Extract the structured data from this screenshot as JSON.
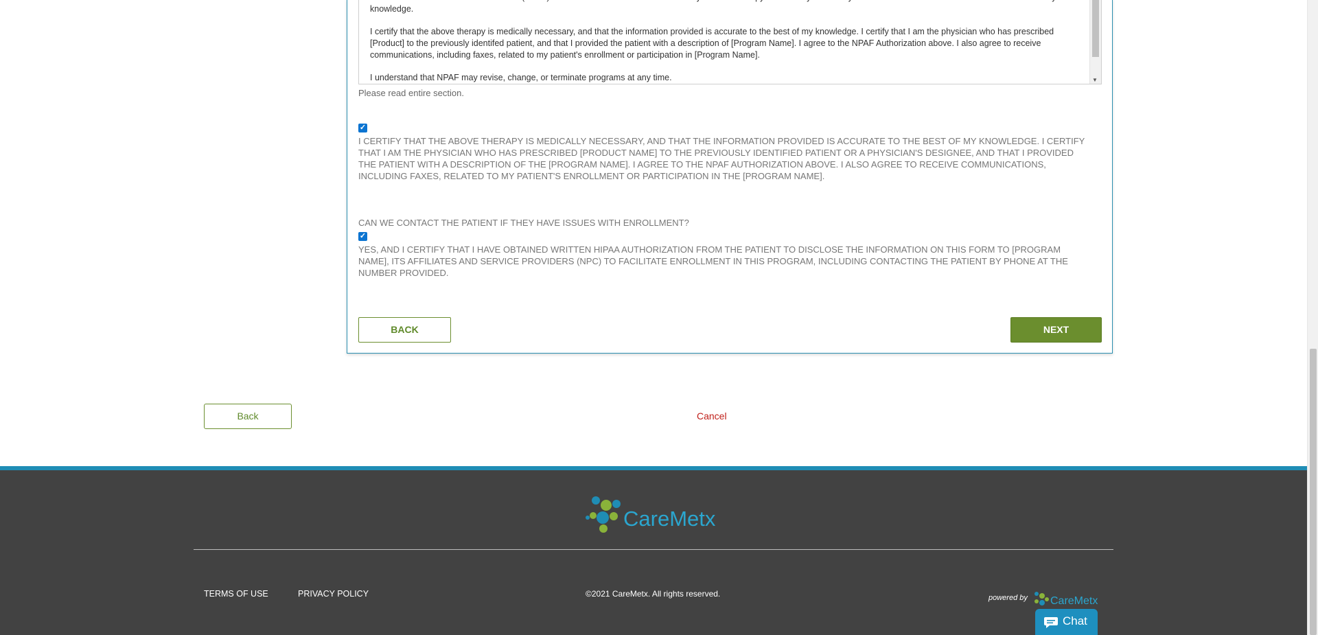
{
  "legal": {
    "paragraphs": [
      "Novartis Patient Assistance Foundation (NPAF) Authorization FOR PHYSICIAN I certify that this therapy is medically necessary and that this information is accurate to the best of my knowledge.",
      "I certify that the above therapy is medically necessary, and that the information provided is accurate to the best of my knowledge. I certify that I am the physician who has prescribed [Product] to the previously identifed patient, and that I provided the patient with a description of [Program Name]. I agree to the NPAF Authorization above. I also agree to receive communications, including faxes, related to my patient's enrollment or participation in [Program Name].",
      "I understand that NPAF may revise, change, or terminate programs at any time."
    ],
    "hint": "Please read entire section."
  },
  "certify": {
    "checked": true,
    "text": "I CERTIFY THAT THE ABOVE THERAPY IS MEDICALLY NECESSARY, AND THAT THE INFORMATION PROVIDED IS ACCURATE TO THE BEST OF MY KNOWLEDGE. I CERTIFY THAT I AM THE PHYSICIAN WHO HAS PRESCRIBED [PRODUCT NAME] TO THE PREVIOUSLY IDENTIFIED PATIENT OR A PHYSICIAN'S DESIGNEE, AND THAT I PROVIDED THE PATIENT WITH A DESCRIPTION OF THE [PROGRAM NAME]. I AGREE TO THE NPAF AUTHORIZATION ABOVE. I ALSO AGREE TO RECEIVE COMMUNICATIONS, INCLUDING FAXES, RELATED TO MY PATIENT'S ENROLLMENT OR PARTICIPATION IN THE [PROGRAM NAME]."
  },
  "contact": {
    "question": "CAN WE CONTACT THE PATIENT IF THEY HAVE ISSUES WITH ENROLLMENT?",
    "checked": true,
    "text": "YES, AND I CERTIFY THAT I HAVE OBTAINED WRITTEN HIPAA AUTHORIZATION FROM THE PATIENT TO DISCLOSE THE INFORMATION ON THIS FORM TO [PROGRAM NAME], ITS AFFILIATES AND SERVICE PROVIDERS (NPC) TO FACILITATE ENROLLMENT IN THIS PROGRAM, INCLUDING CONTACTING THE PATIENT BY PHONE AT THE NUMBER PROVIDED."
  },
  "form_buttons": {
    "back": "BACK",
    "next": "NEXT"
  },
  "page_buttons": {
    "back": "Back",
    "cancel": "Cancel"
  },
  "footer": {
    "logo_text": "CareMetx",
    "terms": "TERMS OF USE",
    "privacy": "PRIVACY POLICY",
    "copyright": "©2021 CareMetx. All rights reserved.",
    "powered_by": "powered by",
    "powered_logo": "CareMetx"
  },
  "chat": {
    "label": "Chat"
  },
  "colors": {
    "accent_green": "#6b8e2e",
    "brand_blue": "#1f8db5",
    "footer_bg": "#424242",
    "cancel_red": "#c0201a"
  }
}
